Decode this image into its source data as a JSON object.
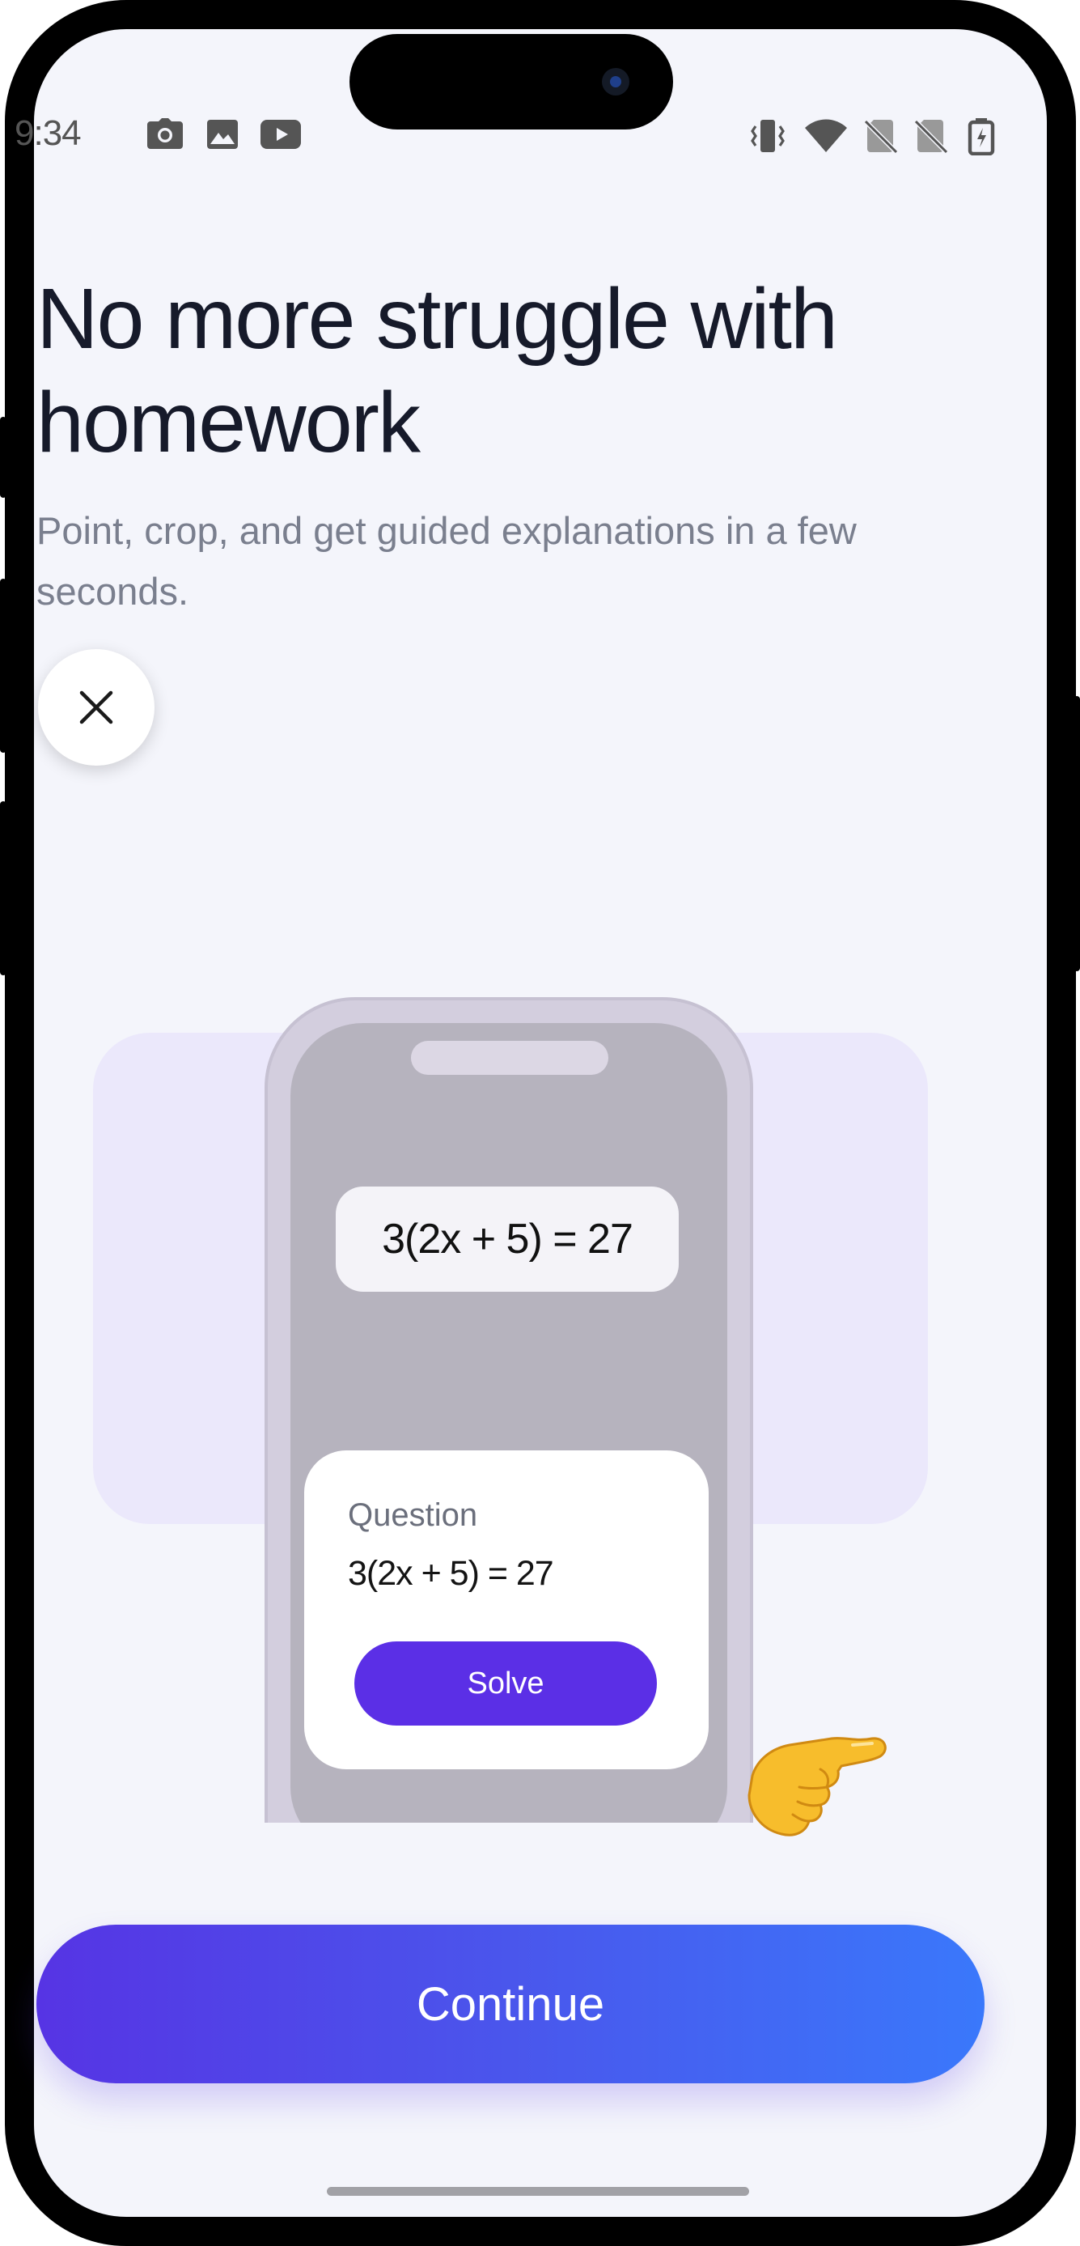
{
  "status_bar": {
    "time": "9:34",
    "left_icons": [
      "camera-icon",
      "image-icon",
      "youtube-icon"
    ],
    "right_icons": [
      "vibrate-icon",
      "wifi-icon",
      "no-sim-icon",
      "no-sim-icon",
      "battery-charging-icon"
    ]
  },
  "onboarding": {
    "title": "No more struggle with homework",
    "subtitle": "Point, crop, and get guided explanations in a few seconds.",
    "close_icon": "close-icon"
  },
  "illustration": {
    "equation": "3(2x + 5) = 27",
    "card": {
      "label": "Question",
      "equation": "3(2x + 5) = 27",
      "solve_label": "Solve"
    },
    "pointer": "pointing-hand-icon"
  },
  "footer": {
    "continue_label": "Continue"
  },
  "colors": {
    "background": "#f4f5fb",
    "accent_purple": "#5b2fe6",
    "gradient_start": "#5634e4",
    "gradient_end": "#3a78fb",
    "illustration_bg": "#ebe8fb"
  }
}
